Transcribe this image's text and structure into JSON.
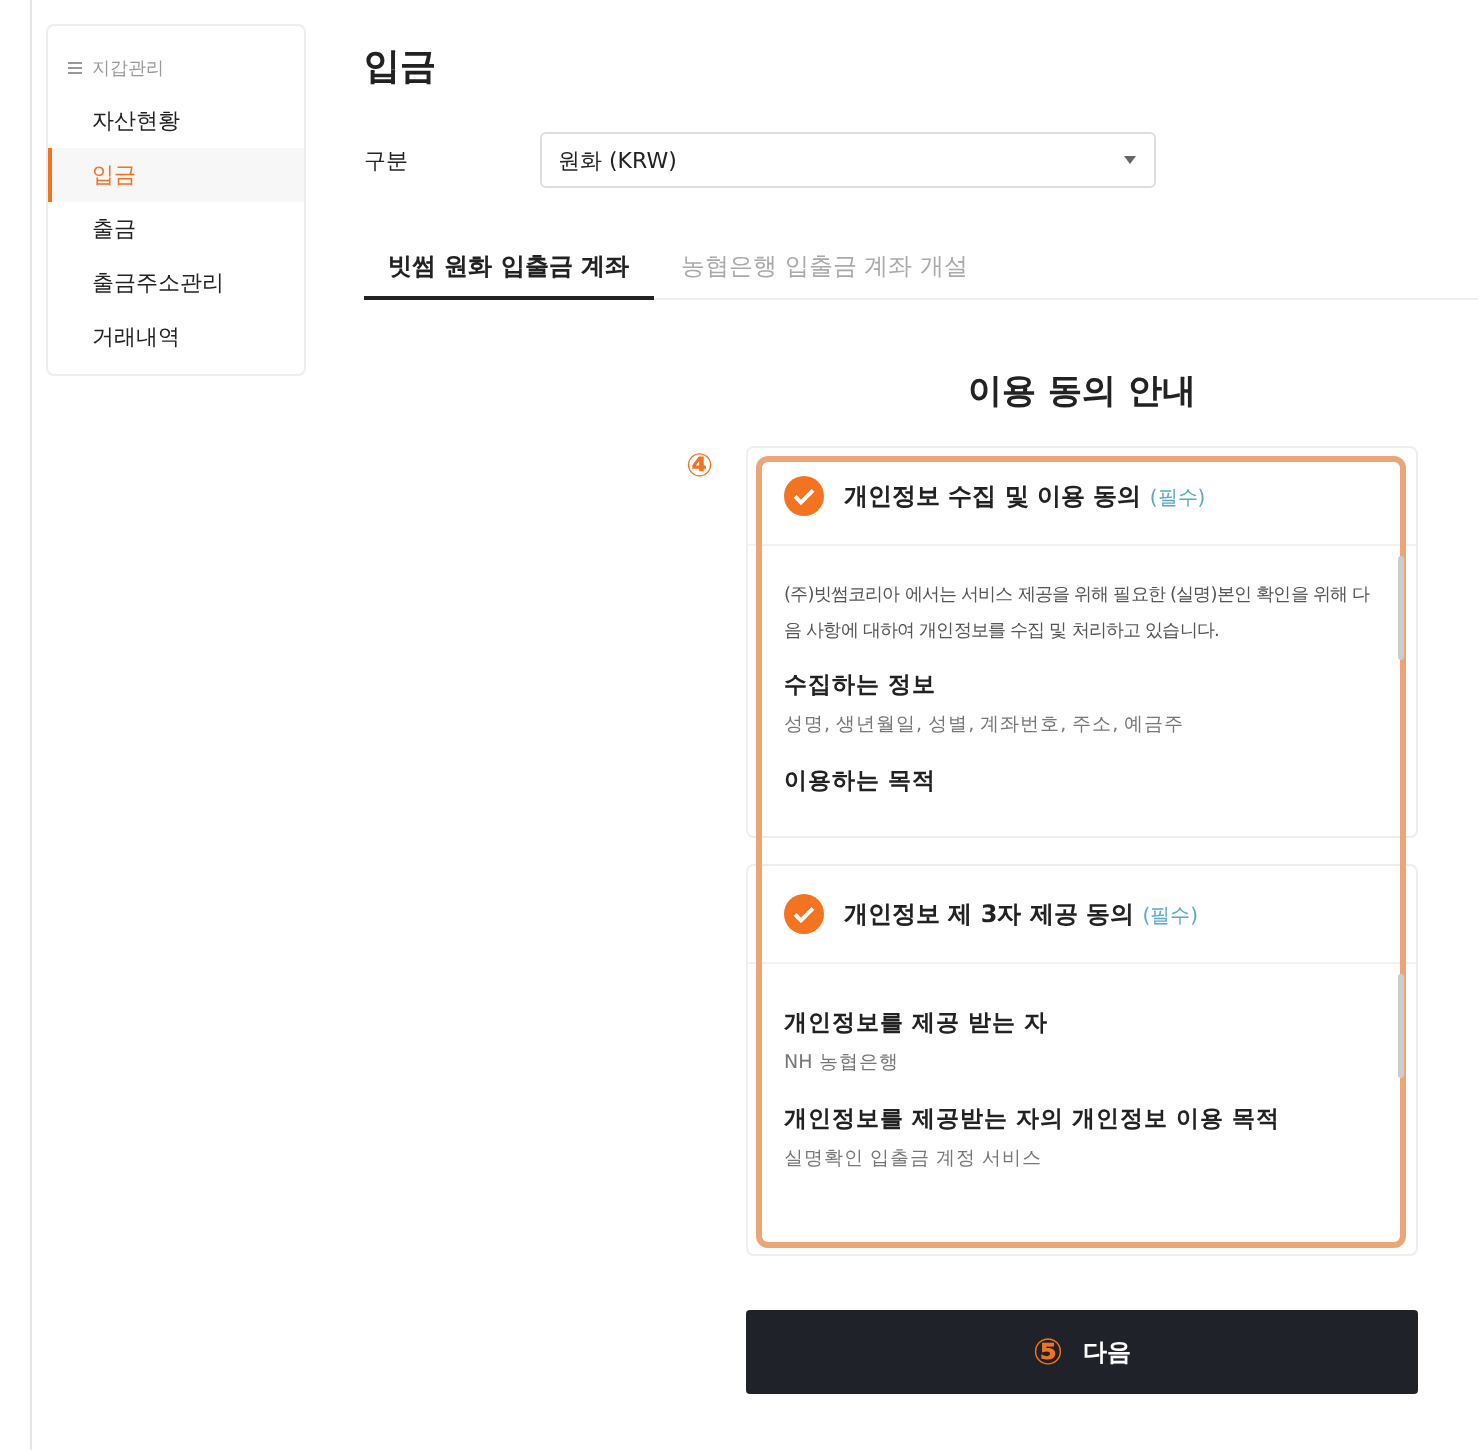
{
  "sidebar": {
    "heading": "지갑관리",
    "items": [
      {
        "label": "자산현황",
        "selected": false
      },
      {
        "label": "입금",
        "selected": true
      },
      {
        "label": "출금",
        "selected": false
      },
      {
        "label": "출금주소관리",
        "selected": false
      },
      {
        "label": "거래내역",
        "selected": false
      }
    ]
  },
  "page_title": "입금",
  "category": {
    "label": "구분",
    "value": "원화 (KRW)"
  },
  "tabs": [
    {
      "label": "빗썸 원화 입출금 계좌",
      "selected": true
    },
    {
      "label": "농협은행 입출금 계좌 개설",
      "selected": false
    }
  ],
  "section_title": "이용 동의 안내",
  "step_markers": [
    "④",
    "⑤"
  ],
  "agreements": [
    {
      "title": "개인정보 수집 및 이용 동의",
      "required": "(필수)",
      "checked": true,
      "intro": "(주)빗썸코리아 에서는 서비스 제공을 위해 필요한 (실명)본인 확인을 위해 다음 사항에 대하여 개인정보를 수집 및 처리하고 있습니다.",
      "sections": [
        {
          "heading": "수집하는 정보",
          "body": "성명, 생년월일, 성별, 계좌번호, 주소, 예금주"
        },
        {
          "heading": "이용하는 목적"
        }
      ]
    },
    {
      "title": "개인정보 제 3자 제공 동의",
      "required": "(필수)",
      "checked": true,
      "sections": [
        {
          "heading": "개인정보를 제공 받는 자",
          "body": "NH 농협은행"
        },
        {
          "heading": "개인정보를 제공받는 자의 개인정보 이용 목적",
          "body": "실명확인 입출금 계정 서비스"
        }
      ]
    }
  ],
  "next_button": "다음"
}
